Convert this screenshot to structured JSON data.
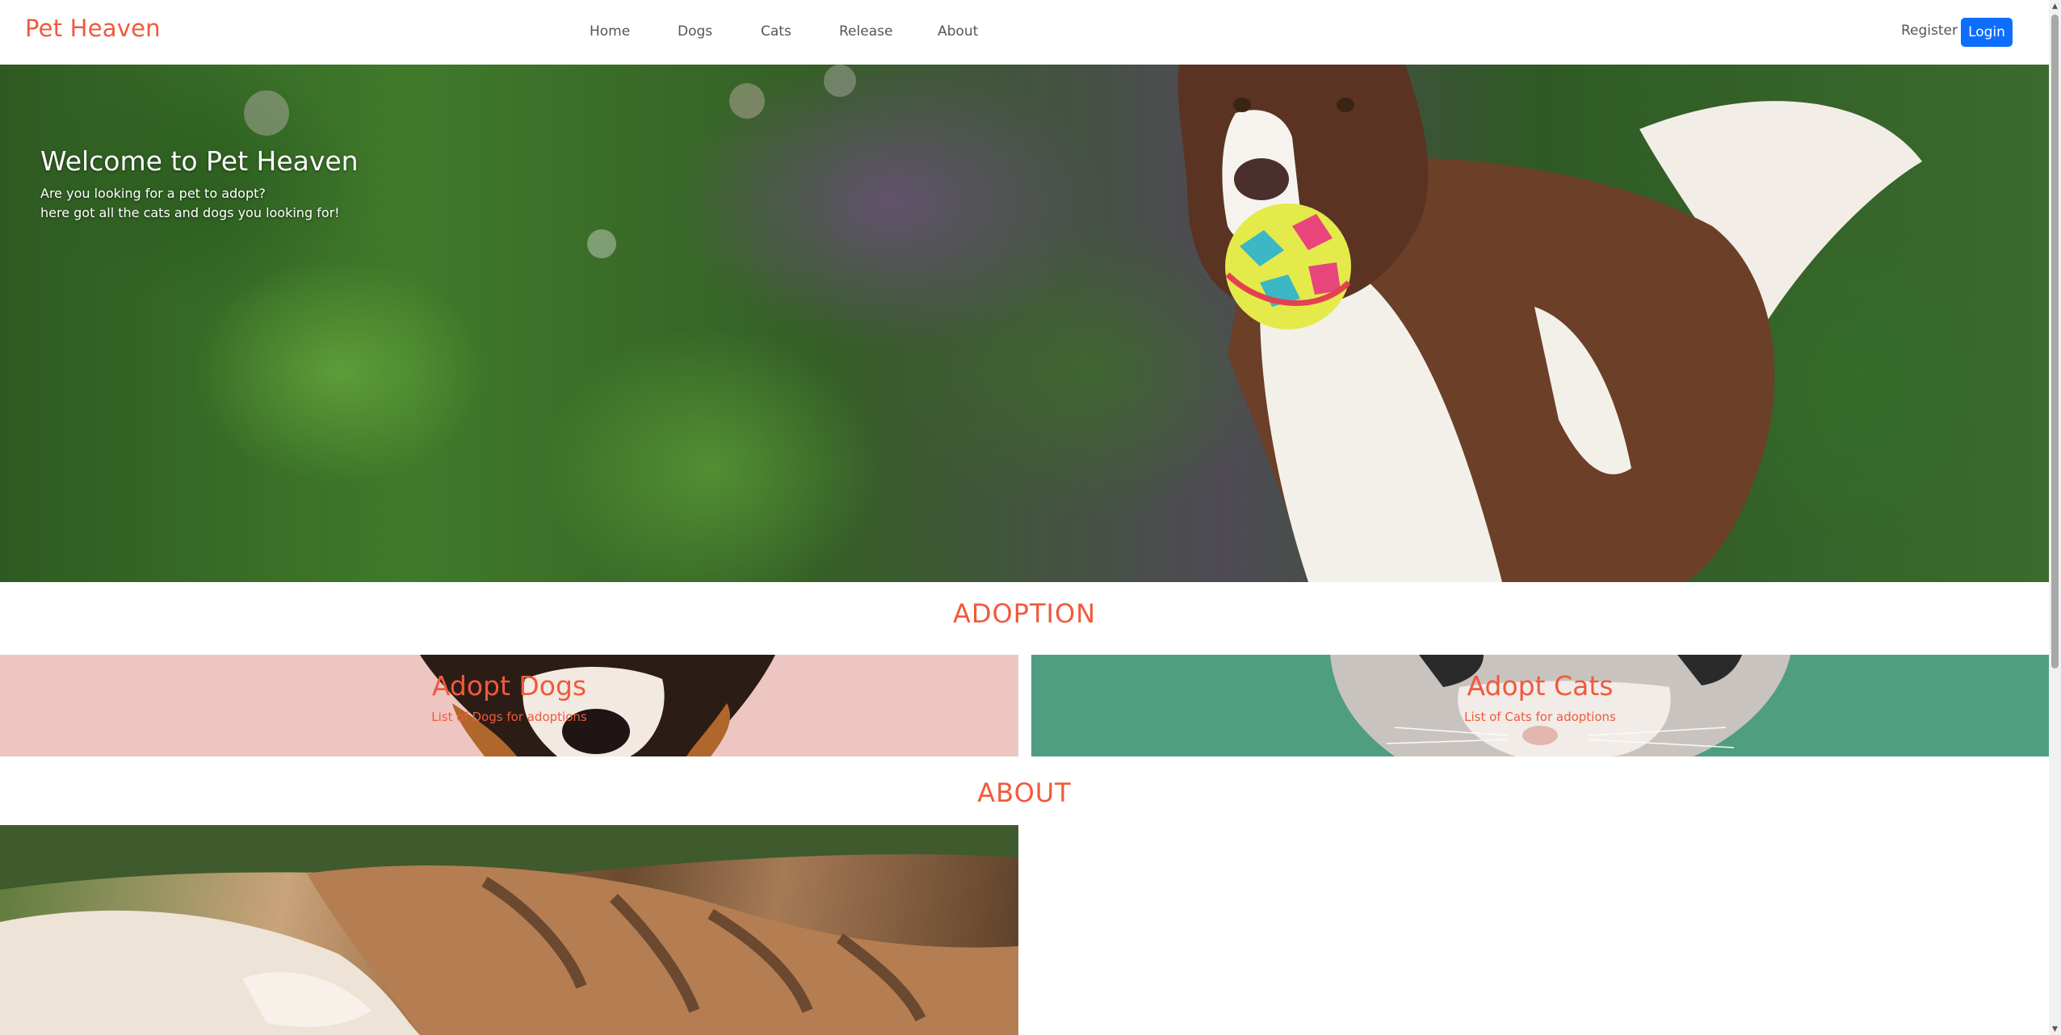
{
  "brand": "Pet Heaven",
  "nav": {
    "links": [
      "Home",
      "Dogs",
      "Cats",
      "Release",
      "About"
    ],
    "register": "Register",
    "login": "Login"
  },
  "hero": {
    "title": "Welcome to Pet Heaven",
    "line1": "Are you looking for a pet to adopt?",
    "line2": "here got all the cats and dogs you looking for!"
  },
  "adoption": {
    "heading": "ADOPTION",
    "dogs": {
      "title": "Adopt Dogs",
      "subtitle": "List of Dogs for adoptions"
    },
    "cats": {
      "title": "Adopt Cats",
      "subtitle": "List of Cats for adoptions"
    }
  },
  "about": {
    "heading": "ABOUT"
  },
  "colors": {
    "accent": "#f05a3c",
    "login_button": "#0d6efd",
    "dogs_card": "#eec6c1",
    "cats_card": "#4f9e82"
  },
  "icons": {
    "scroll_up": "scroll-up-arrow-icon",
    "scroll_down": "scroll-down-arrow-icon"
  }
}
